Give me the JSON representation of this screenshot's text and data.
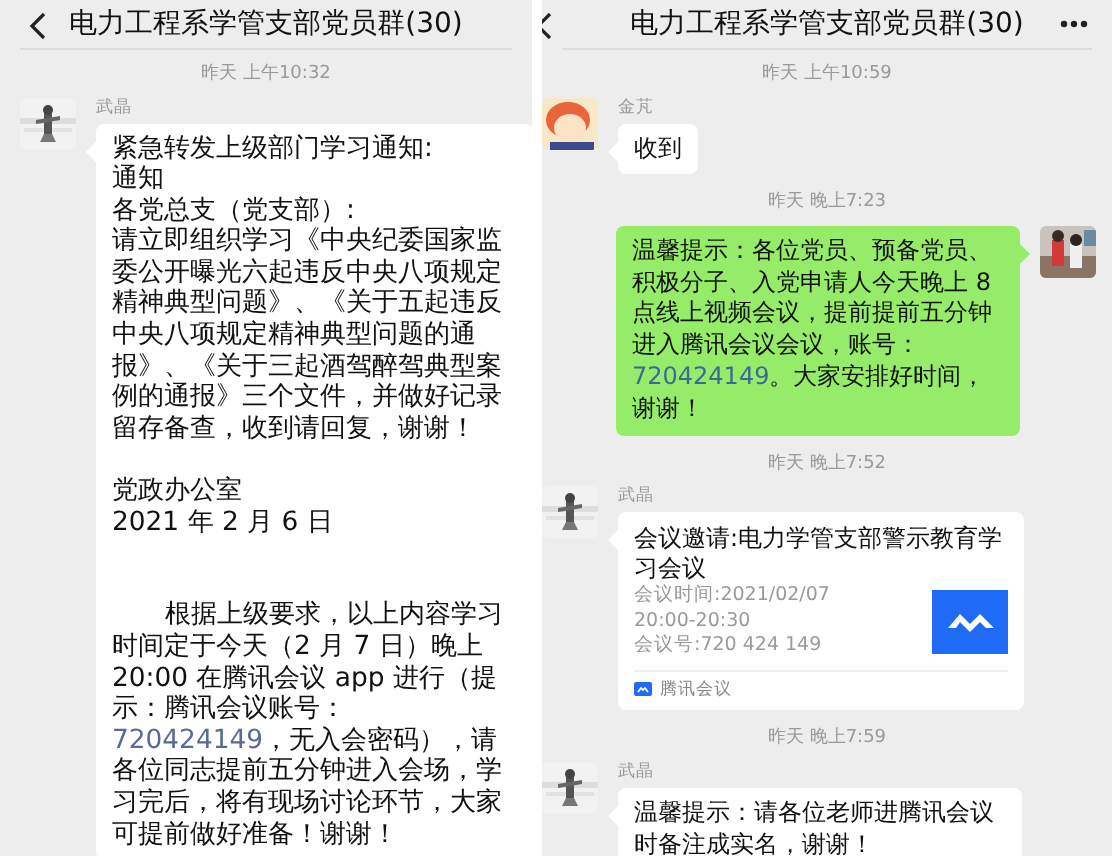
{
  "panels": [
    {
      "title": "电力工程系学管支部党员群(30)",
      "menu_button": false,
      "messages": [
        {
          "kind": "time",
          "text": "昨天 上午10:32"
        },
        {
          "kind": "incoming",
          "sender": "武晶",
          "blocks": [
            [
              {
                "text": "紧急转发上级部门学习通知:"
              },
              {
                "text": "通知"
              },
              {
                "text": "各党总支（党支部）:"
              },
              {
                "text": "请立即组织学习《中央纪委国家监委公开曝光六起违反中央八项规定精神典型问题》、《关于五起违反中央八项规定精神典型问题的通报》、《关于三起酒驾醉驾典型案例的通报》三个文件，并做好记录留存备查，收到请回复，谢谢！"
              }
            ],
            [
              {
                "text": "党政办公室"
              },
              {
                "text": "2021 年 2 月 6 日"
              }
            ],
            [
              {
                "indent": true,
                "parts": [
                  {
                    "text": "根据上级要求，以上内容学习时间定于今天（2 月 7 日）晚上 20:00 在腾讯会议 app 进行（提示：腾讯会议账号："
                  },
                  {
                    "kind": "link",
                    "text": "720424149"
                  },
                  {
                    "text": "，无入会密码），请各位同志提前五分钟进入会场，学习完后，将有现场讨论环节，大家可提前做好准备！谢谢！"
                  }
                ]
              }
            ]
          ]
        }
      ]
    },
    {
      "title": "电力工程系学管支部党员群(30)",
      "menu_button": true,
      "messages": [
        {
          "kind": "time",
          "text": "昨天 上午10:59"
        },
        {
          "kind": "incoming",
          "sender": "金芃",
          "blocks": [
            [
              {
                "text": "收到"
              }
            ]
          ]
        },
        {
          "kind": "time",
          "text": "昨天 晚上7:23"
        },
        {
          "kind": "outgoing",
          "blocks": [
            [
              {
                "parts": [
                  {
                    "text": "温馨提示：各位党员、预备党员、积极分子、入党申请人今天晚上 8 点线上视频会议，提前提前五分钟进入腾讯会议会议，账号："
                  },
                  {
                    "kind": "link",
                    "text": "720424149"
                  },
                  {
                    "text": "。大家安排好时间，谢谢！"
                  }
                ]
              }
            ]
          ]
        },
        {
          "kind": "time",
          "text": "昨天 晚上7:52"
        },
        {
          "kind": "card",
          "sender": "武晶",
          "title": "会议邀请:电力学管支部警示教育学习会议",
          "lines": [
            "会议时间:2021/02/07",
            "20:00-20:30",
            "会议号:720 424 149"
          ],
          "source": "腾讯会议"
        },
        {
          "kind": "time",
          "text": "昨天 晚上7:59"
        },
        {
          "kind": "incoming",
          "sender": "武晶",
          "blocks": [
            [
              {
                "text": "温馨提示：请各位老师进腾讯会议时备注成实名，谢谢！"
              }
            ]
          ]
        }
      ]
    }
  ]
}
